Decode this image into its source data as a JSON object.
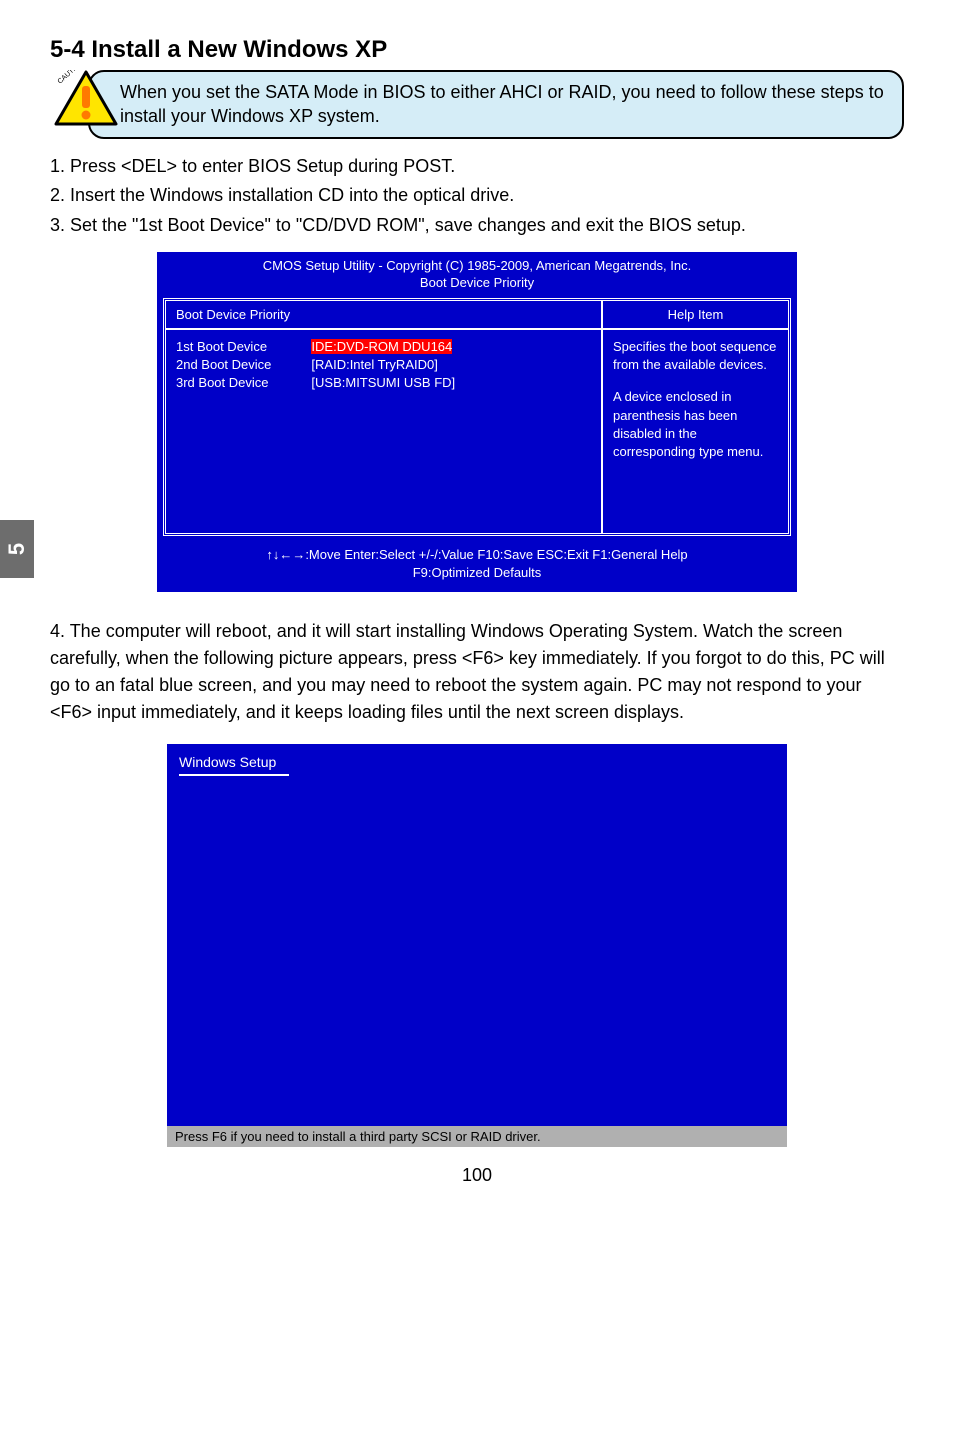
{
  "side_tab": "5",
  "heading": "5-4 Install a New Windows XP",
  "caution_note": "When you set the SATA Mode in BIOS to either AHCI or RAID, you need to follow these steps to install your Windows XP system.",
  "steps": {
    "s1": "1. Press <DEL> to enter BIOS Setup during POST.",
    "s2": "2. Insert the Windows installation CD into the optical drive.",
    "s3": "3. Set the \"1st Boot Device\" to \"CD/DVD ROM\", save changes and exit the BIOS setup."
  },
  "bios": {
    "title_l1": "CMOS Setup Utility - Copyright (C) 1985-2009, American Megatrends, Inc.",
    "title_l2": "Boot Device Priority",
    "head_left": "Boot Device Priority",
    "head_right": "Help Item",
    "rows": {
      "r1_label": "1st Boot Device",
      "r1_value": "IDE:DVD-ROM DDU164",
      "r2_label": "2nd Boot Device",
      "r2_value": "[RAID:Intel TryRAID0]",
      "r3_label": "3rd Boot Device",
      "r3_value": "[USB:MITSUMI USB FD]"
    },
    "help_p1": "Specifies the boot sequence from the available devices.",
    "help_p2": "A device enclosed in parenthesis has been disabled in the corresponding type menu.",
    "footer_l1": "↑↓←→:Move   Enter:Select    +/-/:Value   F10:Save   ESC:Exit    F1:General Help",
    "footer_l2": "F9:Optimized Defaults"
  },
  "para4_lead": "4. The computer will reboot, and it will start installing Windows Operating System. ",
  "para4_rest": "Watch the screen carefully, when the following picture appears, press <F6> key immediately. If you forgot to do this, PC will go to an fatal blue screen, and you may need to reboot the system again. PC may not respond to your <F6> input immediately, and it keeps loading files until the next screen displays.",
  "winsetup": {
    "title": "Windows Setup",
    "status": "Press F6 if you need to install a third party SCSI or RAID driver."
  },
  "page_number": "100"
}
